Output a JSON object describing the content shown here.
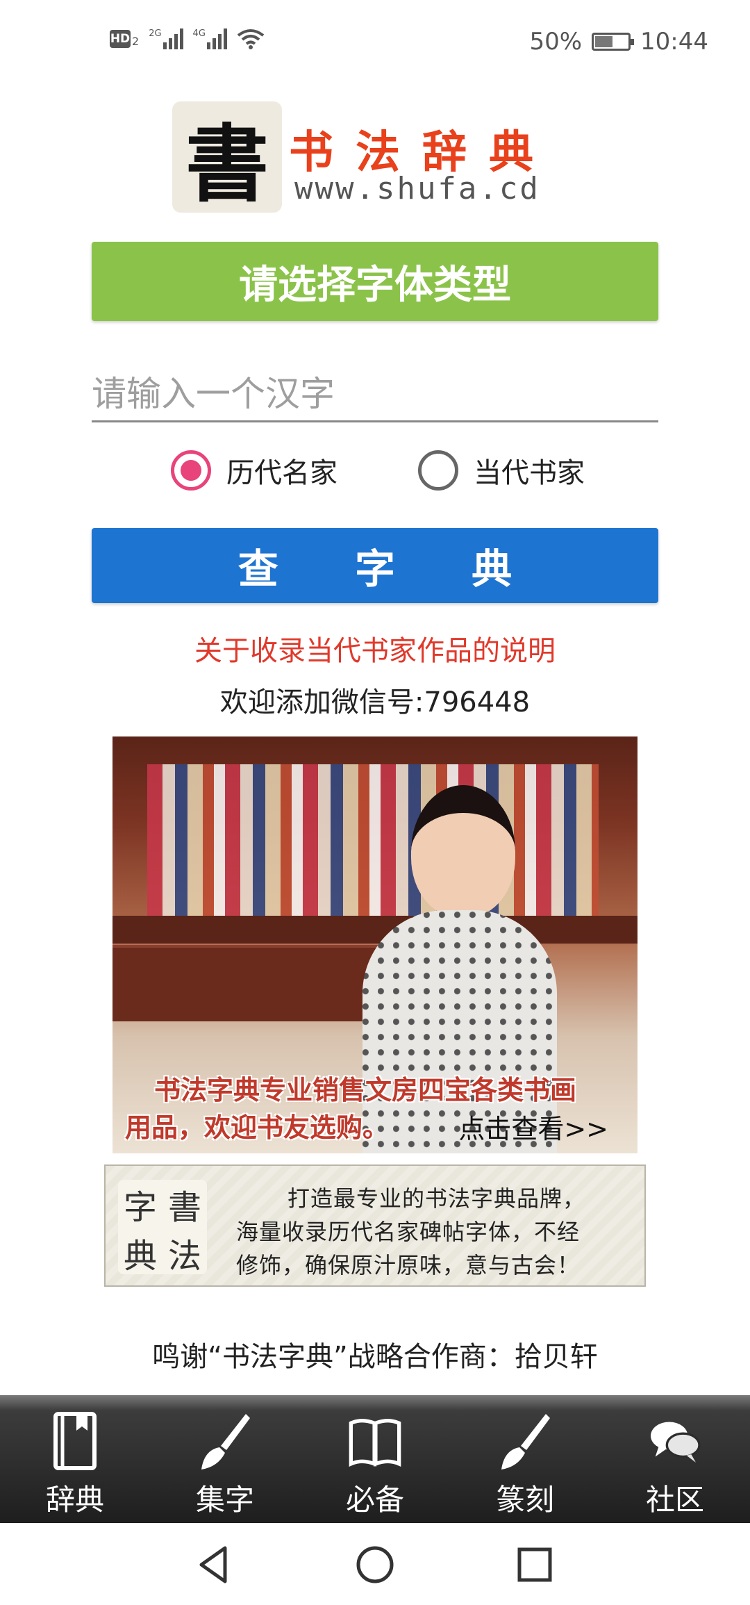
{
  "status_bar": {
    "hd_badge": "HD",
    "hd_sub": "2",
    "sim1_label": "2G",
    "sim2_label": "4G",
    "battery_percent_text": "50%",
    "battery_level": 0.5,
    "time": "10:44",
    "icons": [
      "hd-icon",
      "signal-icon",
      "signal-icon",
      "wifi-icon",
      "battery-icon"
    ]
  },
  "logo": {
    "seal_char": "書",
    "title": "书法辞典",
    "url": "www.shufa.cd"
  },
  "font_type_button": "请选择字体类型",
  "search": {
    "placeholder": "请输入一个汉字",
    "value": ""
  },
  "radio_options": [
    {
      "label": "历代名家",
      "selected": true
    },
    {
      "label": "当代书家",
      "selected": false
    }
  ],
  "lookup_button": "查 字 典",
  "notice_link": "关于收录当代书家作品的说明",
  "wechat_text": "欢迎添加微信号:796448",
  "promo_banner": {
    "caption_line1": "书法字典专业销售文房四宝各类书画",
    "caption_line2": "用品，欢迎书友选购。",
    "cta": "点击查看>>"
  },
  "brand_banner": {
    "seal_chars": [
      "字",
      "書",
      "典",
      "法"
    ],
    "line1": "打造最专业的书法字典品牌，",
    "line2": "海量收录历代名家碑帖字体，不经",
    "line3": "修饰，确保原汁原味，意与古会！"
  },
  "thanks_text": "鸣谢“书法字典”战略合作商：拾贝轩",
  "bottom_nav": [
    {
      "label": "辞典",
      "icon": "book-icon"
    },
    {
      "label": "集字",
      "icon": "brush-icon"
    },
    {
      "label": "必备",
      "icon": "open-book-icon"
    },
    {
      "label": "篆刻",
      "icon": "brush-icon"
    },
    {
      "label": "社区",
      "icon": "chat-bubbles-icon"
    }
  ],
  "system_nav": [
    "back-icon",
    "home-icon",
    "recents-icon"
  ],
  "colors": {
    "green_button": "#8bc34a",
    "blue_button": "#1e74d1",
    "radio_accent": "#e8437a",
    "notice_red": "#e0392b",
    "logo_red": "#e8411c"
  }
}
